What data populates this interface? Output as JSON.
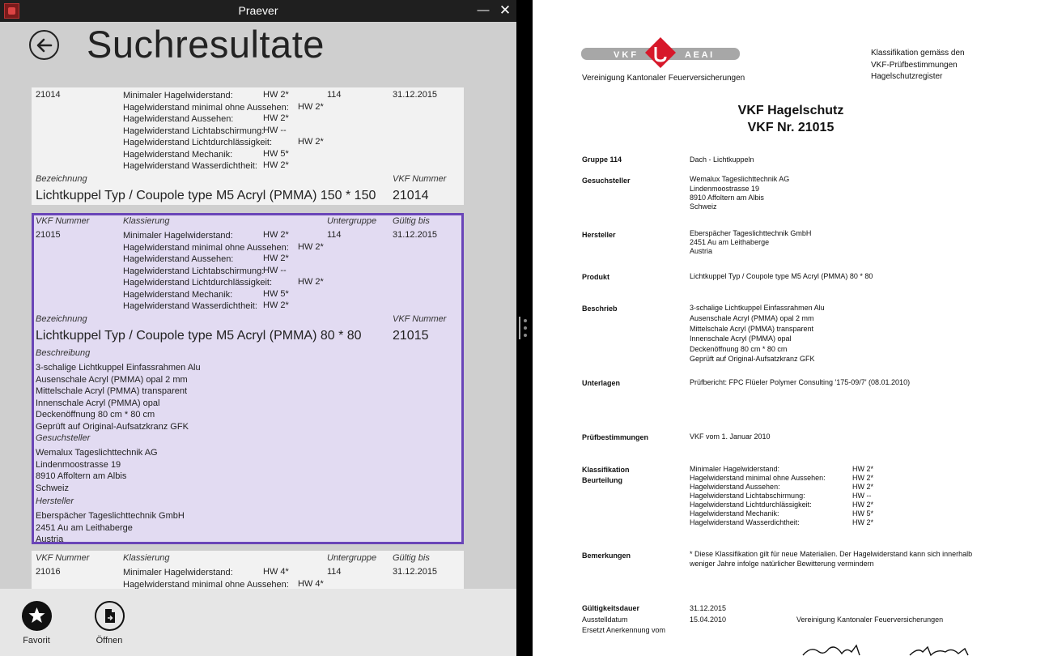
{
  "window": {
    "title": "Praever"
  },
  "header": {
    "title": "Suchresultate"
  },
  "labels": {
    "vkf_nummer": "VKF Nummer",
    "klassierung": "Klassierung",
    "untergruppe": "Untergruppe",
    "gueltig_bis": "Gültig bis",
    "bezeichnung": "Bezeichnung",
    "beschreibung": "Beschreibung",
    "gesuchsteller": "Gesuchsteller",
    "hersteller": "Hersteller"
  },
  "results": [
    {
      "vkf_nr": "21014",
      "untergruppe": "114",
      "gueltig_bis": "31.12.2015",
      "klassierung": [
        {
          "name": "Minimaler Hagelwiderstand:",
          "value": "HW 2*"
        },
        {
          "name": "Hagelwiderstand minimal ohne Aussehen:",
          "value": "HW 2*"
        },
        {
          "name": "Hagelwiderstand Aussehen:",
          "value": "HW 2*"
        },
        {
          "name": "Hagelwiderstand Lichtabschirmung:",
          "value": "HW --"
        },
        {
          "name": "Hagelwiderstand Lichtdurchlässigkeit:",
          "value": "HW 2*"
        },
        {
          "name": "Hagelwiderstand Mechanik:",
          "value": "HW 5*"
        },
        {
          "name": "Hagelwiderstand Wasserdichtheit:",
          "value": "HW 2*"
        }
      ],
      "bezeichnung": "Lichtkuppel Typ / Coupole type M5 Acryl (PMMA) 150 * 150"
    },
    {
      "vkf_nr": "21015",
      "untergruppe": "114",
      "gueltig_bis": "31.12.2015",
      "klassierung": [
        {
          "name": "Minimaler Hagelwiderstand:",
          "value": "HW 2*"
        },
        {
          "name": "Hagelwiderstand minimal ohne Aussehen:",
          "value": "HW 2*"
        },
        {
          "name": "Hagelwiderstand Aussehen:",
          "value": "HW 2*"
        },
        {
          "name": "Hagelwiderstand Lichtabschirmung:",
          "value": "HW --"
        },
        {
          "name": "Hagelwiderstand Lichtdurchlässigkeit:",
          "value": "HW 2*"
        },
        {
          "name": "Hagelwiderstand Mechanik:",
          "value": "HW 5*"
        },
        {
          "name": "Hagelwiderstand Wasserdichtheit:",
          "value": "HW 2*"
        }
      ],
      "bezeichnung": "Lichtkuppel Typ / Coupole type M5 Acryl (PMMA) 80 * 80",
      "beschreibung": [
        "3-schalige Lichtkuppel Einfassrahmen Alu",
        "Ausenschale Acryl (PMMA) opal 2 mm",
        "Mittelschale Acryl (PMMA) transparent",
        "Innenschale Acryl (PMMA) opal",
        "Deckenöffnung 80 cm * 80 cm",
        "Geprüft auf Original-Aufsatzkranz GFK"
      ],
      "gesuchsteller": [
        "Wemalux Tageslichttechnik AG",
        "Lindenmoostrasse 19",
        "8910 Affoltern am Albis",
        "Schweiz"
      ],
      "hersteller": [
        "Eberspächer Tageslichttechnik GmbH",
        "2451 Au am Leithaberge",
        "Austria"
      ]
    },
    {
      "vkf_nr": "21016",
      "untergruppe": "114",
      "gueltig_bis": "31.12.2015",
      "klassierung": [
        {
          "name": "Minimaler Hagelwiderstand:",
          "value": "HW 4*"
        },
        {
          "name": "Hagelwiderstand minimal ohne Aussehen:",
          "value": "HW 4*"
        }
      ]
    }
  ],
  "appbar": {
    "favorit": "Favorit",
    "oeffnen": "Öffnen"
  },
  "document": {
    "logo_left": "V K F",
    "logo_right": "A E A I",
    "org": "Vereinigung Kantonaler Feuerversicherungen",
    "klass_note": [
      "Klassifikation gemäss den",
      "VKF-Prüfbestimmungen",
      "Hagelschutzregister"
    ],
    "title1": "VKF Hagelschutz",
    "title2": "VKF Nr. 21015",
    "gruppe_key": "Gruppe 114",
    "gruppe_value": "Dach - Lichtkuppeln",
    "gesuchsteller_key": "Gesuchsteller",
    "gesuchsteller": [
      "Wemalux Tageslichttechnik AG",
      "Lindenmoostrasse 19",
      "8910 Affoltern am Albis",
      "Schweiz"
    ],
    "hersteller_key": "Hersteller",
    "hersteller": [
      "Eberspächer Tageslichttechnik GmbH",
      "2451 Au am Leithaberge",
      "Austria"
    ],
    "produkt_key": "Produkt",
    "produkt": "Lichtkuppel Typ / Coupole type M5 Acryl (PMMA) 80 * 80",
    "beschrieb_key": "Beschrieb",
    "beschrieb": [
      "3-schalige Lichtkuppel Einfassrahmen Alu",
      "Ausenschale Acryl (PMMA) opal 2 mm",
      "Mittelschale Acryl (PMMA) transparent",
      "Innenschale Acryl (PMMA) opal",
      "Deckenöffnung 80 cm * 80 cm",
      "Geprüft auf Original-Aufsatzkranz GFK"
    ],
    "unterlagen_key": "Unterlagen",
    "unterlagen": "Prüfbericht: FPC Flüeler Polymer Consulting '175-09/7' (08.01.2010)",
    "pruef_key": "Prüfbestimmungen",
    "pruef": "VKF vom 1. Januar 2010",
    "klassifikation_key": "Klassifikation",
    "beurteilung_key": "Beurteilung",
    "klassifikation": [
      {
        "name": "Minimaler Hagelwiderstand:",
        "value": "HW 2*"
      },
      {
        "name": "Hagelwiderstand minimal ohne Aussehen:",
        "value": "HW 2*"
      },
      {
        "name": "Hagelwiderstand Aussehen:",
        "value": "HW 2*"
      },
      {
        "name": "Hagelwiderstand Lichtabschirmung:",
        "value": "HW --"
      },
      {
        "name": "Hagelwiderstand Lichtdurchlässigkeit:",
        "value": "HW 2*"
      },
      {
        "name": "Hagelwiderstand Mechanik:",
        "value": "HW 5*"
      },
      {
        "name": "Hagelwiderstand Wasserdichtheit:",
        "value": "HW 2*"
      }
    ],
    "bemerkungen_key": "Bemerkungen",
    "bemerkungen": [
      "* Diese Klassifikation gilt für neue Materialien. Der Hagelwiderstand kann sich innerhalb",
      "weniger Jahre infolge natürlicher Bewitterung vermindern"
    ],
    "gueltigkeit_key": "Gültigkeitsdauer",
    "gueltigkeit": "31.12.2015",
    "ausstell_key": "Ausstelldatum",
    "ausstell": "15.04.2010",
    "ersetzt_key": "Ersetzt Anerkennung vom",
    "signer": "Vereinigung Kantonaler Feuerversicherungen"
  },
  "colors": {
    "selection_bg": "#e2dbf2",
    "selection_border": "#6a45b8",
    "logo_red": "#d7182a"
  }
}
